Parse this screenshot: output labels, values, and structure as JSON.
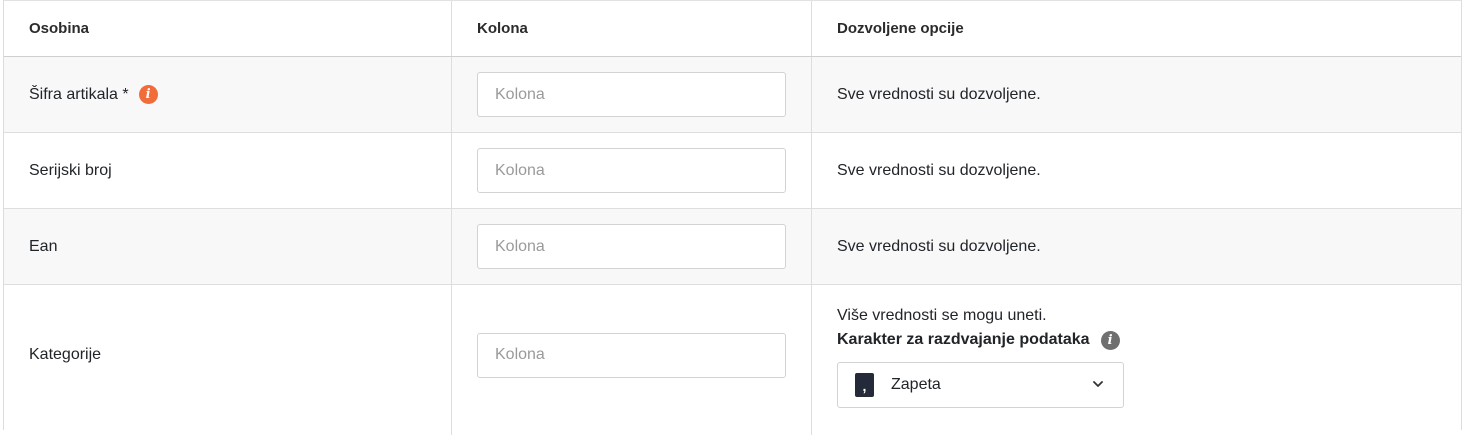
{
  "table": {
    "headers": [
      "Osobina",
      "Kolona",
      "Dozvoljene opcije"
    ],
    "rows": [
      {
        "property": "Šifra artikala *",
        "placeholder": "Kolona",
        "allowed": "Sve vrednosti su dozvoljene."
      },
      {
        "property": "Serijski broj",
        "placeholder": "Kolona",
        "allowed": "Sve vrednosti su dozvoljene."
      },
      {
        "property": "Ean",
        "placeholder": "Kolona",
        "allowed": "Sve vrednosti su dozvoljene."
      },
      {
        "property": "Kategorije",
        "placeholder": "Kolona",
        "allowed": "Više vrednosti se mogu uneti.",
        "separator_label": "Karakter za razdvajanje podataka",
        "separator_key": ",",
        "separator_value": "Zapeta"
      }
    ]
  },
  "icons": {
    "info": "info-icon",
    "chevron": "chevron-down-icon"
  },
  "colors": {
    "info_orange": "#f26b3a",
    "info_gray": "#6f6f6f",
    "key_badge": "#252a3a"
  }
}
